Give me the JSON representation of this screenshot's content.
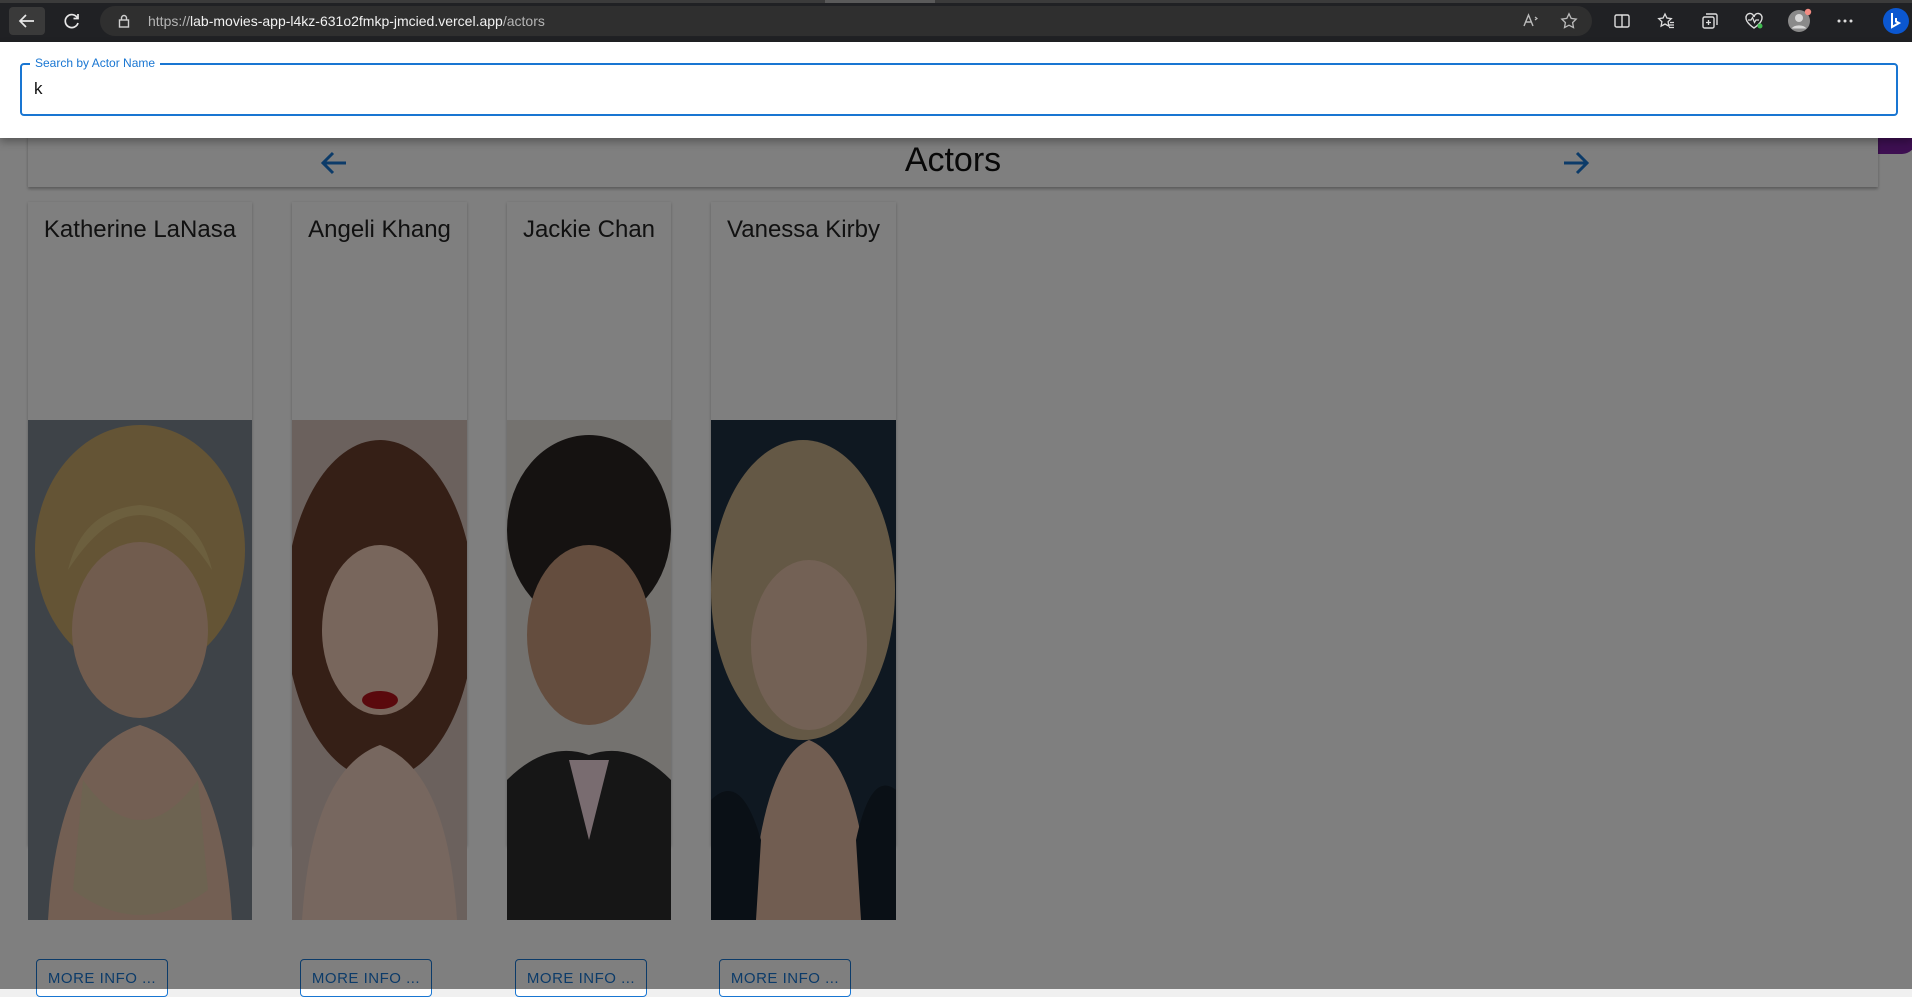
{
  "browser": {
    "url_prefix": "https://",
    "url_host": "lab-movies-app-l4kz-631o2fmkp-jmcied.vercel.app",
    "url_path": "/actors"
  },
  "header": {
    "title": "Actors"
  },
  "actors": [
    {
      "name": "Katherine LaNasa",
      "button": "MORE INFO ..."
    },
    {
      "name": "Angeli Khang",
      "button": "MORE INFO ..."
    },
    {
      "name": "Jackie Chan",
      "button": "MORE INFO ..."
    },
    {
      "name": "Vanessa Kirby",
      "button": "MORE INFO ..."
    }
  ],
  "search": {
    "label": "Search by Actor Name",
    "value": "k"
  },
  "icons": {
    "back": "arrow-left-icon",
    "refresh": "refresh-icon",
    "lock": "lock-icon",
    "read_aloud": "read-aloud-icon",
    "favorite": "star-icon",
    "split": "split-screen-icon",
    "favorites": "favorites-icon",
    "collections": "collections-icon",
    "health": "browser-essentials-icon",
    "profile": "profile-icon",
    "menu": "more-icon",
    "copilot": "copilot-icon"
  },
  "colors": {
    "accent": "#1976d2",
    "fab": "#7b1fa2"
  }
}
